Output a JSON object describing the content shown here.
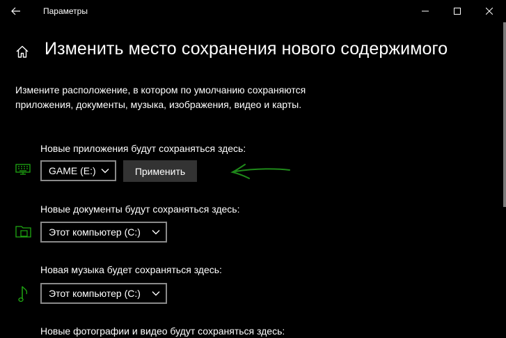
{
  "window": {
    "app_title": "Параметры"
  },
  "page": {
    "title": "Изменить место сохранения нового содержимого",
    "description": "Измените расположение, в котором по умолчанию сохраняются приложения, документы, музыка, изображения, видео и карты."
  },
  "sections": [
    {
      "label": "Новые приложения будут сохраняться здесь:",
      "value": "GAME (E:)",
      "icon": "keyboard-icon",
      "button": "Применить"
    },
    {
      "label": "Новые документы будут сохраняться здесь:",
      "value": "Этот компьютер (C:)",
      "icon": "folder-icon"
    },
    {
      "label": "Новая музыка будет сохраняться здесь:",
      "value": "Этот компьютер (C:)",
      "icon": "music-note-icon"
    },
    {
      "label": "Новые фотографии и видео будут сохраняться здесь:"
    }
  ],
  "colors": {
    "accent": "#1fa812",
    "annotation": "#1f8a1a",
    "background": "#000000",
    "button_bg": "#333333"
  }
}
